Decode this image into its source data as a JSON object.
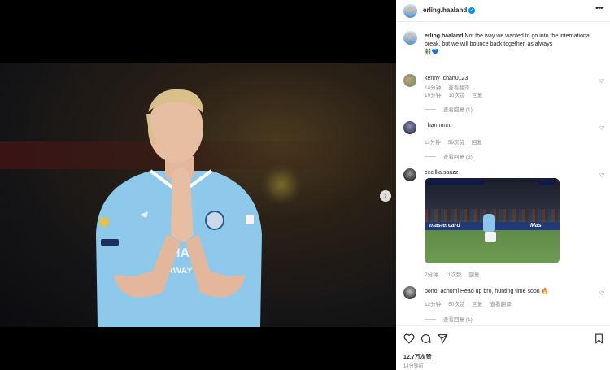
{
  "post": {
    "author": "erling.haaland",
    "verified_icon": "verified-badge-icon",
    "more_icon": "more-options-icon"
  },
  "caption": {
    "author": "erling.haaland",
    "text": "Not the way we wanted to go into the international break, but we will bounce back together, as always",
    "emoji": "👬💙",
    "time": "14分钟",
    "translate": "查看翻译"
  },
  "comments": [
    {
      "user": "kenny_chan0123",
      "text": "",
      "time": "10分钟",
      "likes": "10次赞",
      "reply": "回复",
      "view_replies": "查看回复 (1)"
    },
    {
      "user": "_hannnnn._",
      "text": "",
      "time": "11分钟",
      "likes": "59次赞",
      "reply": "回复",
      "view_replies": "查看回复 (3)"
    },
    {
      "user": "cecillia.sanzz",
      "text": "",
      "time": "7分钟",
      "likes": "11次赞",
      "reply": "回复",
      "thumb_board_left": "mastercard",
      "thumb_board_right": "Mas"
    },
    {
      "user": "bono_achumi",
      "text": "Head up bro, hunting time soon 🔥",
      "time": "12分钟",
      "likes": "50次赞",
      "reply": "回复",
      "translate": "查看翻译",
      "view_replies": "查看回复 (1)"
    }
  ],
  "footer": {
    "likes": "12.7万次赞",
    "posted": "14分钟前"
  },
  "colors": {
    "verified": "#0095f6",
    "text": "#262626",
    "muted": "#8e8e8e"
  }
}
